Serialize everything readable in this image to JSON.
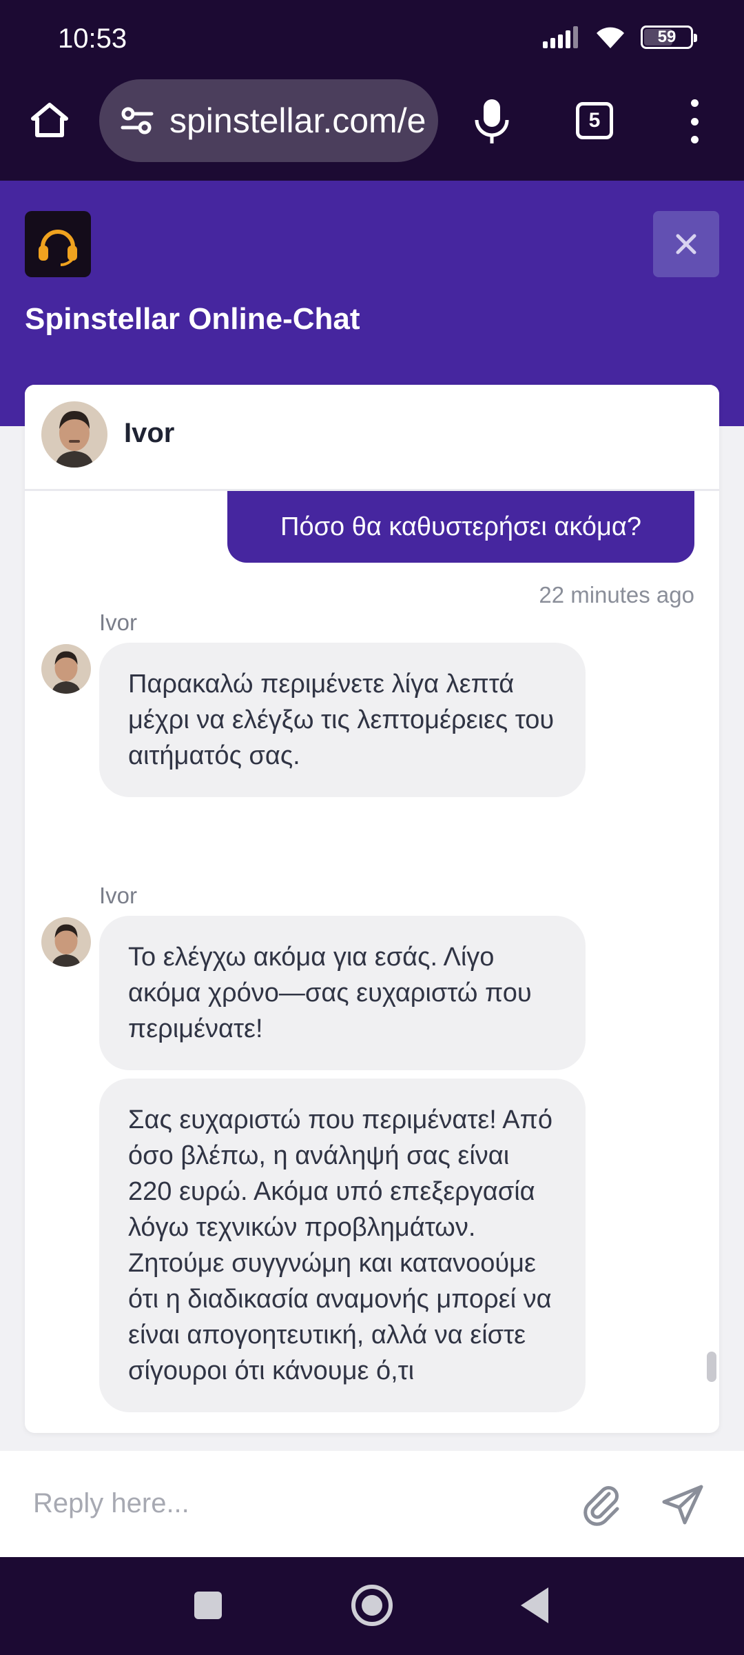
{
  "status_bar": {
    "time": "10:53",
    "battery": "59",
    "battery_level_pct": 59
  },
  "browser": {
    "url": "spinstellar.com/e",
    "tab_count": "5"
  },
  "chat": {
    "title": "Spinstellar Online-Chat",
    "agent_name": "Ivor",
    "accent_color": "#46269f",
    "messages": {
      "user_message": "Πόσο θα καθυστερήσει ακόμα?",
      "user_timestamp": "22 minutes ago",
      "group1_sender": "Ivor",
      "group1_text": "Παρακαλώ περιμένετε λίγα λεπτά μέχρι να ελέγξω τις λεπτομέρειες του αιτήματός σας.",
      "group2_sender": "Ivor",
      "group2_text1": "Το ελέγχω ακόμα για εσάς. Λίγο ακόμα χρόνο—σας ευχαριστώ που περιμένατε!",
      "group2_text2": "Σας ευχαριστώ που περιμένατε! Από όσο βλέπω, η ανάληψή σας είναι 220 ευρώ. Ακόμα υπό επεξεργασία λόγω τεχνικών προβλημάτων. Ζητούμε συγγνώμη και κατανοούμε ότι η διαδικασία αναμονής μπορεί να είναι απογοητευτική, αλλά να είστε σίγουροι ότι κάνουμε ό,τι"
    },
    "reply": {
      "placeholder": "Reply here..."
    }
  },
  "icons": {
    "home": "home-icon",
    "tune": "site-settings-icon",
    "mic": "mic-icon",
    "menu": "more-vert-icon",
    "close": "close-icon",
    "attach": "paperclip-icon",
    "send": "send-icon"
  }
}
